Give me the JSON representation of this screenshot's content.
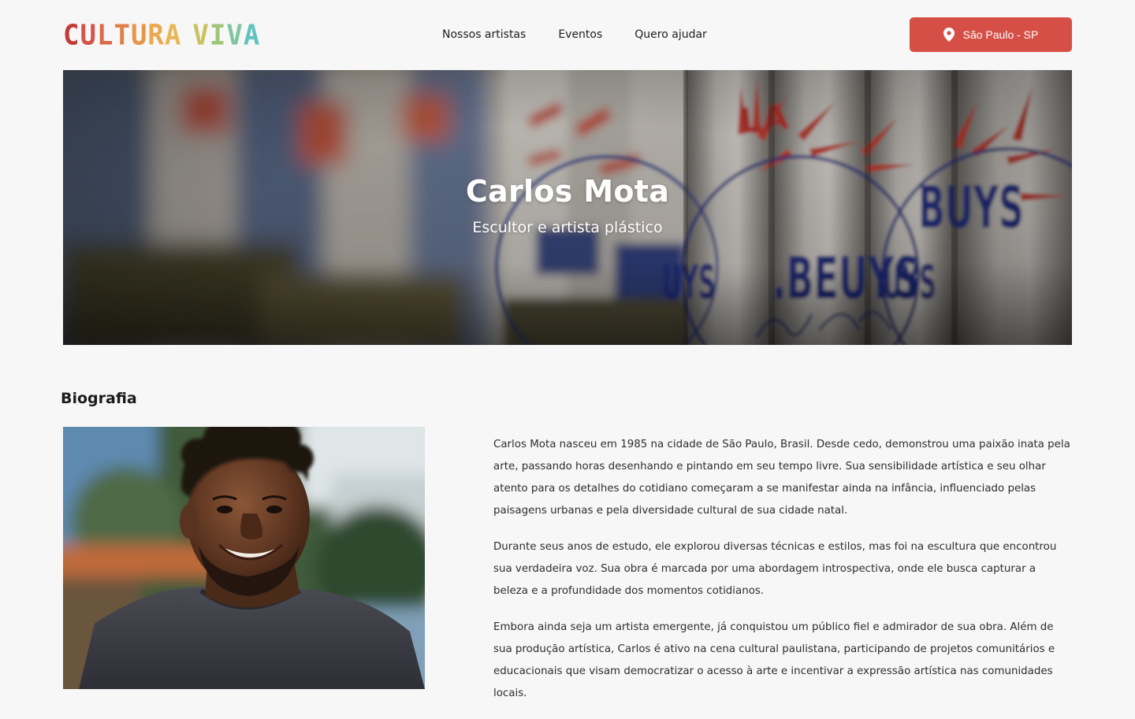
{
  "header": {
    "logo": {
      "text": "CULTURA VIVA",
      "colors": [
        "#c23b36",
        "#d4544a",
        "#dc6a4a",
        "#e27e48",
        "#e8944b",
        "#eda74e",
        "#e8b856",
        "#c9c25d",
        "#9fc57a",
        "#7ec6a0",
        "#62c3bd"
      ]
    },
    "nav": [
      {
        "label": "Nossos artistas"
      },
      {
        "label": "Eventos"
      },
      {
        "label": "Quero ajudar"
      }
    ],
    "location_button": {
      "label": "São Paulo - SP",
      "icon": "map-pin-icon",
      "color": "#d64f46"
    }
  },
  "hero": {
    "name": "Carlos Mota",
    "subtitle": "Escultor e artista plástico"
  },
  "biography": {
    "heading": "Biografia",
    "paragraphs": [
      "Carlos Mota nasceu em 1985 na cidade de São Paulo, Brasil. Desde cedo, demonstrou uma paixão inata pela arte, passando horas desenhando e pintando em seu tempo livre. Sua sensibilidade artística e seu olhar atento para os detalhes do cotidiano começaram a se manifestar ainda na infância, influenciado pelas paisagens urbanas e pela diversidade cultural de sua cidade natal.",
      "Durante seus anos de estudo, ele explorou diversas técnicas e estilos, mas foi na escultura que encontrou sua verdadeira voz. Sua obra é marcada por uma abordagem introspectiva, onde ele busca capturar a beleza e a profundidade dos momentos cotidianos.",
      "Embora ainda seja um artista emergente, já conquistou um público fiel e admirador de sua obra. Além de sua produção artística, Carlos é ativo na cena cultural paulistana, participando de projetos comunitários e educacionais que visam democratizar o acesso à arte e incentivar a expressão artística nas comunidades locais."
    ]
  }
}
